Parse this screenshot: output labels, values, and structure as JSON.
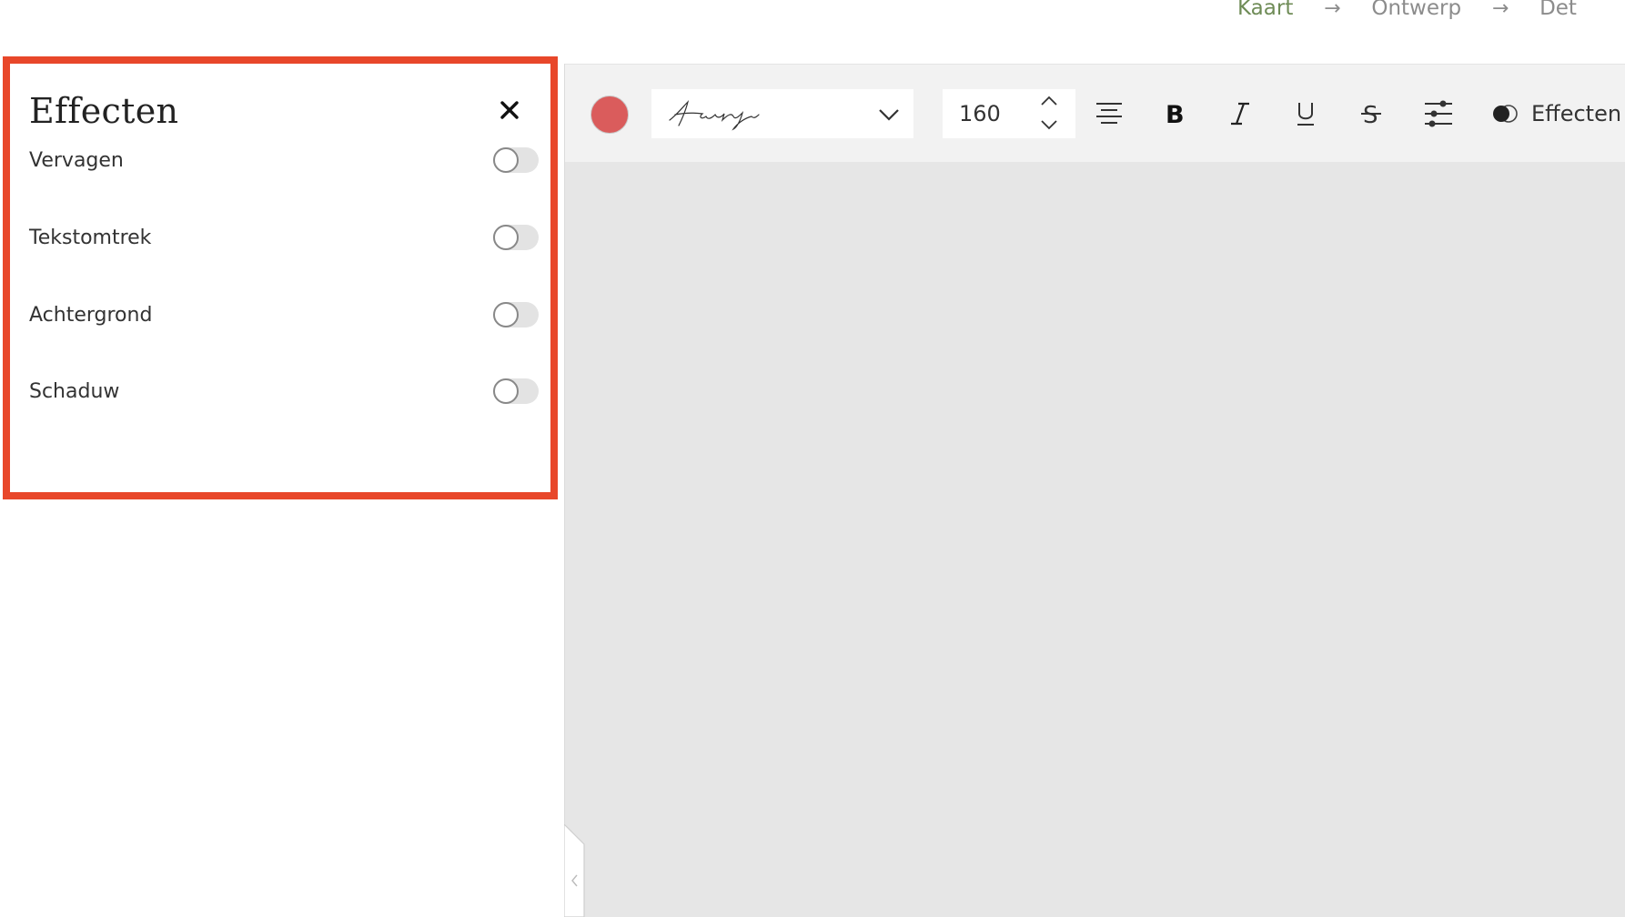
{
  "steps": {
    "step1": "Kaart",
    "arrow1": "→",
    "step2": "Ontwerp",
    "arrow2": "→",
    "step3": "Det"
  },
  "effects_panel": {
    "title": "Effecten",
    "close_icon": "close-icon",
    "items": [
      {
        "label": "Vervagen",
        "enabled": false
      },
      {
        "label": "Tekstomtrek",
        "enabled": false
      },
      {
        "label": "Achtergrond",
        "enabled": false
      },
      {
        "label": "Schaduw",
        "enabled": false
      }
    ]
  },
  "toolbar": {
    "color": "#da5c5c",
    "font_size": "160",
    "effects_label": "Effecten",
    "icons": [
      "align-center-icon",
      "bold-icon",
      "italic-icon",
      "underline-icon",
      "strikethrough-icon",
      "sliders-icon",
      "effects-icon"
    ]
  },
  "colors": {
    "panel_border": "#e8472a",
    "active_step": "#6f8c57",
    "canvas_bg": "#e6e6e6"
  }
}
